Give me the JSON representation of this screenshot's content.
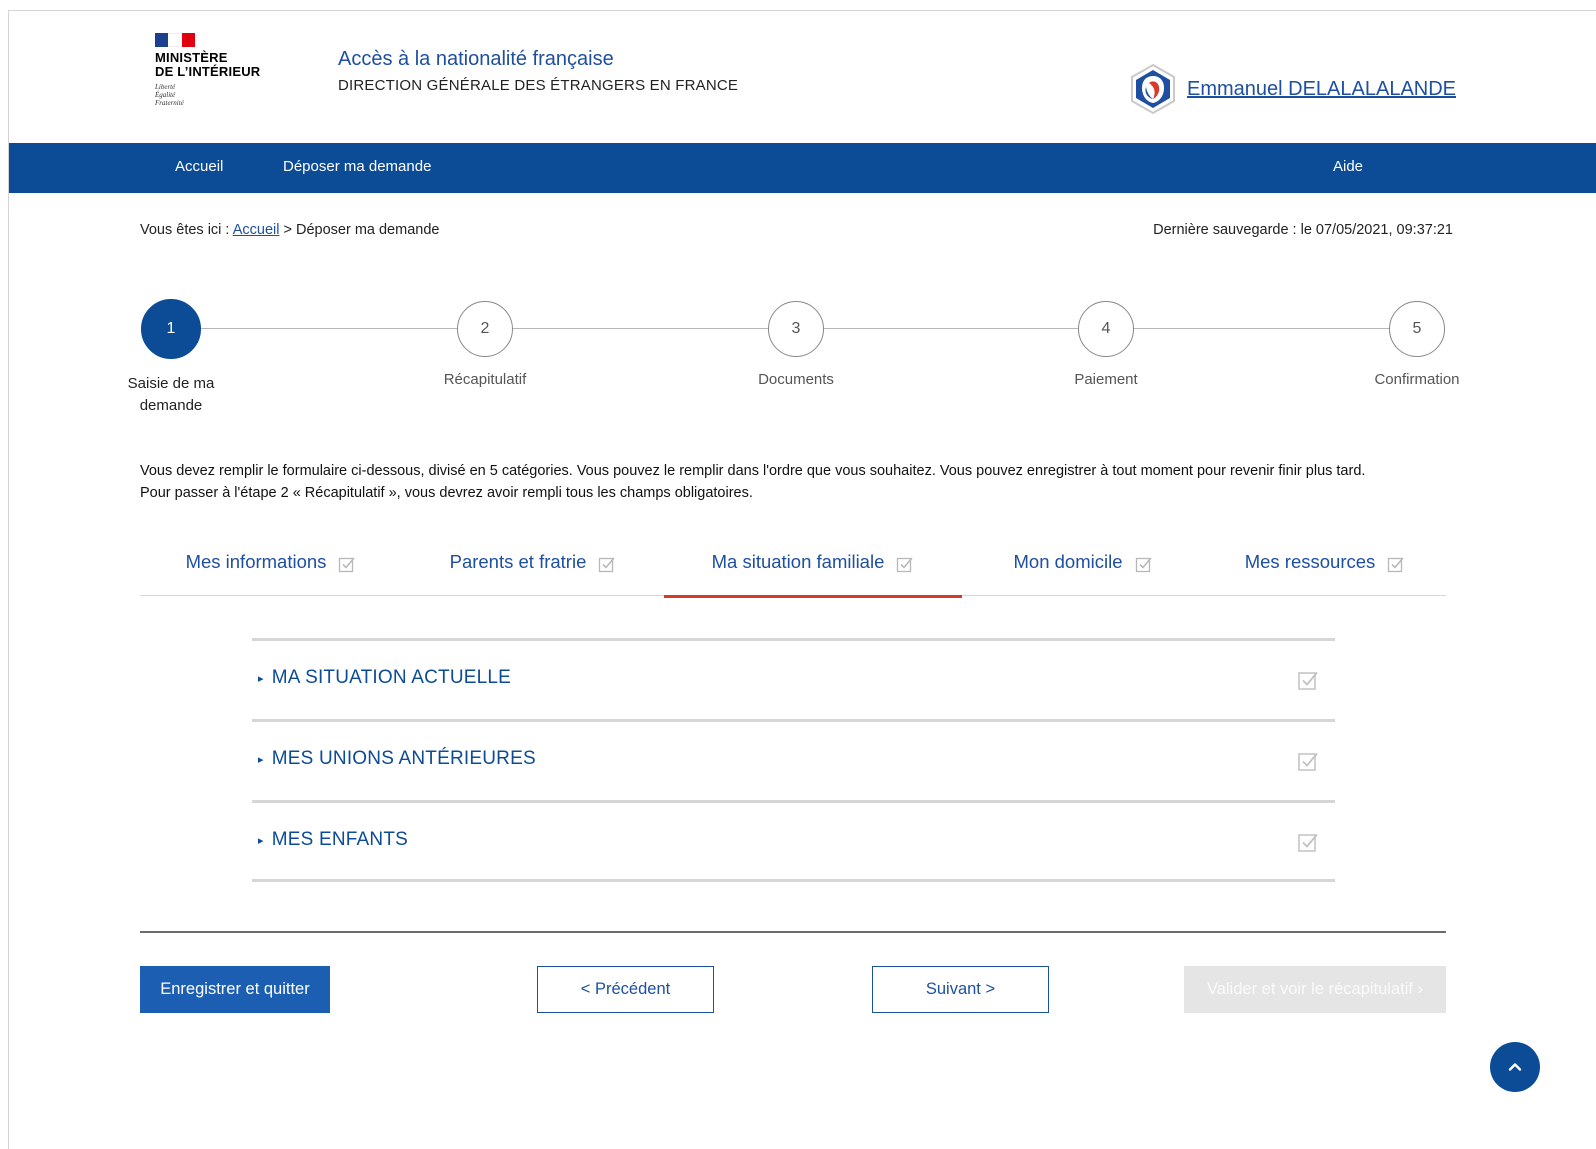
{
  "header": {
    "logo": {
      "line1": "MINISTÈRE",
      "line2": "DE L’INTÉRIEUR",
      "motto": [
        "Liberté",
        "Égalité",
        "Fraternité"
      ],
      "flag_colors": [
        "#1d3f8f",
        "#ffffff",
        "#e1000f"
      ]
    },
    "title": "Accès à la nationalité française",
    "subtitle": "DIRECTION GÉNÉRALE DES ÉTRANGERS EN FRANCE",
    "user_name": "Emmanuel DELALALALANDE",
    "user_icon": "user-avatar-icon"
  },
  "nav": {
    "items": [
      "Accueil",
      "Déposer ma demande"
    ],
    "help": "Aide"
  },
  "breadcrumb": {
    "prefix": "Vous êtes ici : ",
    "home": "Accueil",
    "separator": " > ",
    "current": "Déposer ma demande"
  },
  "last_save": "Dernière sauvegarde : le 07/05/2021, 09:37:21",
  "stepper": {
    "steps": [
      {
        "number": "1",
        "label_line1": "Saisie de ma",
        "label_line2": "demande",
        "active": true
      },
      {
        "number": "2",
        "label": "Récapitulatif"
      },
      {
        "number": "3",
        "label": "Documents"
      },
      {
        "number": "4",
        "label": "Paiement"
      },
      {
        "number": "5",
        "label": "Confirmation"
      }
    ]
  },
  "intro": {
    "line1": "Vous devez remplir le formulaire ci-dessous, divisé en 5 catégories. Vous pouvez le remplir dans l'ordre que vous souhaitez. Vous pouvez enregistrer à tout moment pour revenir finir plus tard.",
    "line2": "Pour passer à l'étape 2 « Récapitulatif », vous devrez avoir rempli tous les champs obligatoires."
  },
  "tabs": [
    {
      "label": "Mes informations"
    },
    {
      "label": "Parents et fratrie"
    },
    {
      "label": "Ma situation familiale",
      "active": true
    },
    {
      "label": "Mon domicile"
    },
    {
      "label": "Mes ressources"
    }
  ],
  "sections": [
    {
      "title": "MA SITUATION ACTUELLE"
    },
    {
      "title": "MES UNIONS ANTÉRIEURES"
    },
    {
      "title": "MES ENFANTS"
    }
  ],
  "buttons": {
    "save_quit": "Enregistrer et quitter",
    "previous": "< Précédent",
    "next": "Suivant >",
    "validate": "Valider et voir le récapitulatif ›"
  },
  "colors": {
    "primary": "#0c4b96",
    "link": "#1e4fa0",
    "tab_underline": "#d63b2a"
  }
}
